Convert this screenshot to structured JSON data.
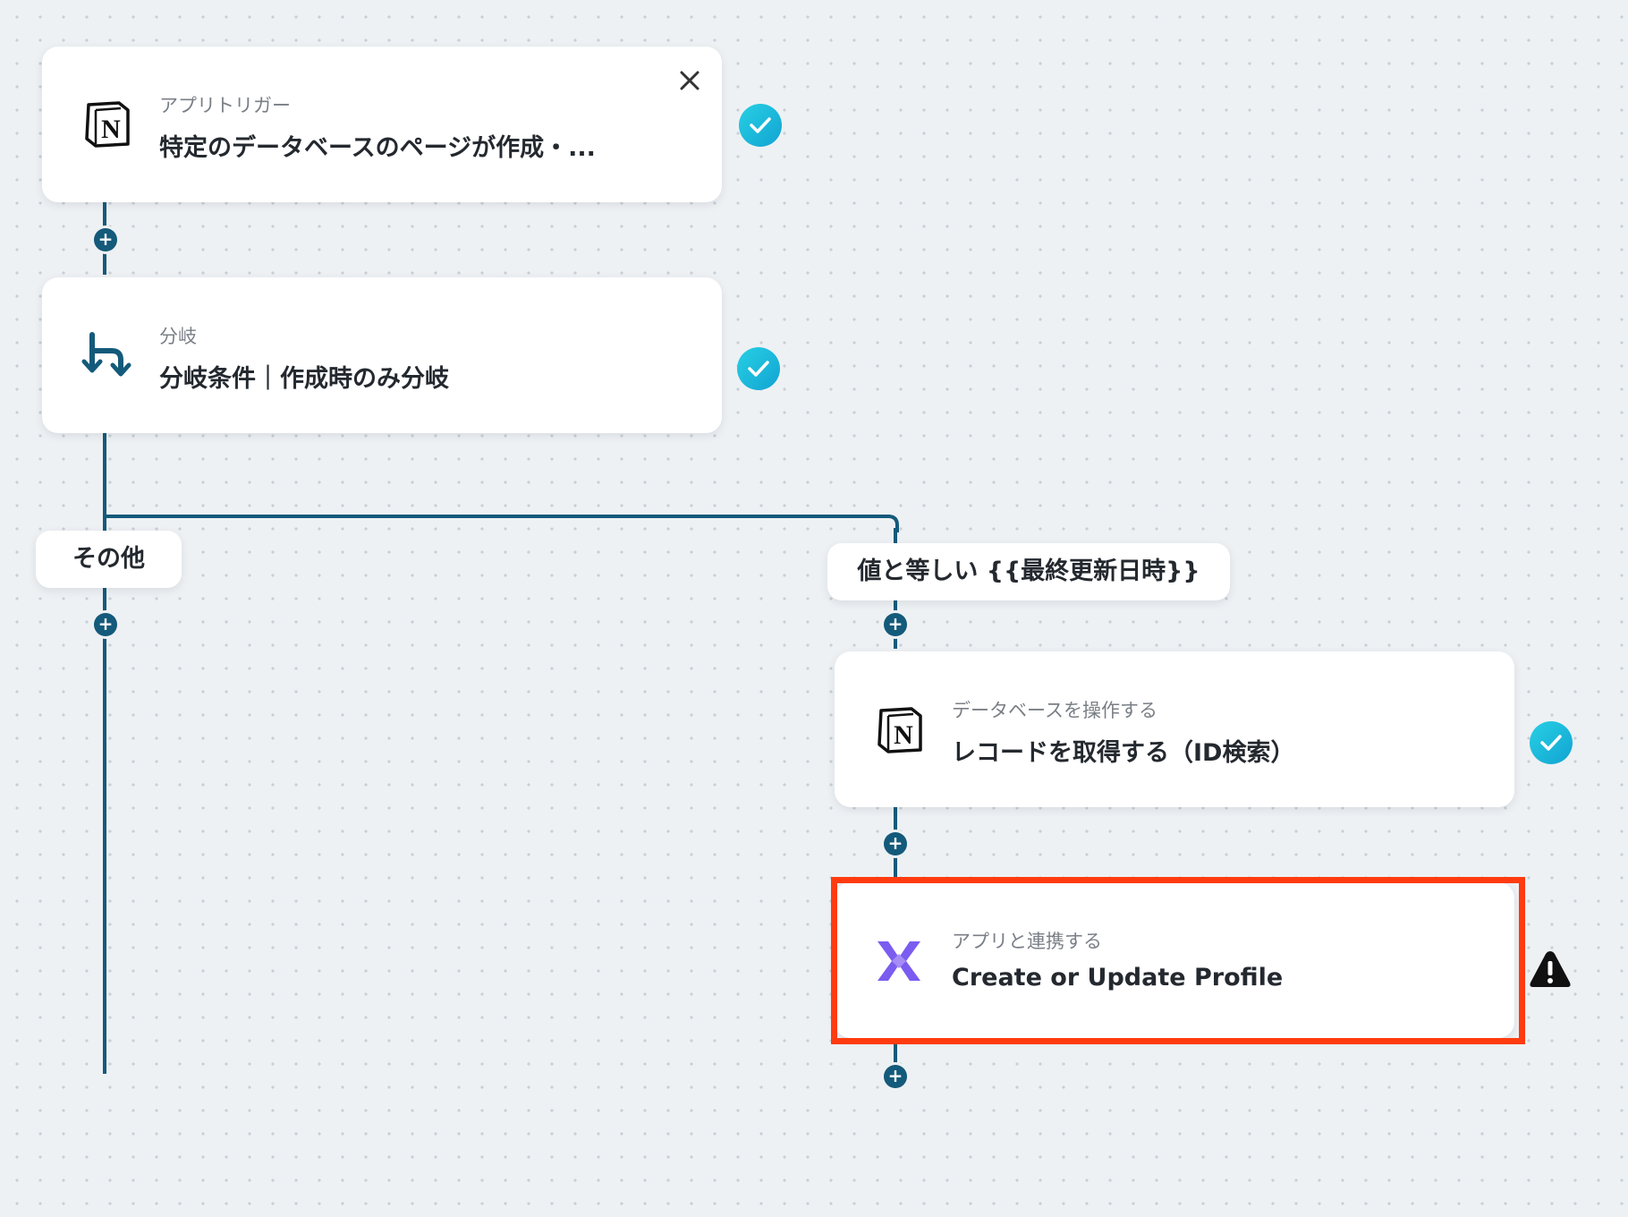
{
  "steps": {
    "trigger": {
      "category": "アプリトリガー",
      "title": "特定のデータベースのページが作成・..."
    },
    "branch": {
      "category": "分岐",
      "title": "分岐条件｜作成時のみ分岐"
    },
    "notion_db": {
      "category": "データベースを操作する",
      "title": "レコードを取得する（ID検索）"
    },
    "app_link": {
      "category": "アプリと連携する",
      "title": "Create or Update Profile"
    }
  },
  "branch_labels": {
    "other": "その他",
    "equals": "値と等しい {{最終更新日時}}"
  },
  "colors": {
    "line": "#145a7a",
    "check": "#12a3d2",
    "highlight": "#ff3b0f",
    "klaviyo_icon": "#7b5cf0"
  },
  "icons": {
    "trigger": "notion-icon",
    "branch": "branch-icon",
    "notion_db": "notion-icon",
    "app_link": "klaviyo-x-icon",
    "status_ok": "check-icon",
    "status_warn": "warning-icon",
    "close": "close-icon",
    "add": "plus-icon"
  }
}
